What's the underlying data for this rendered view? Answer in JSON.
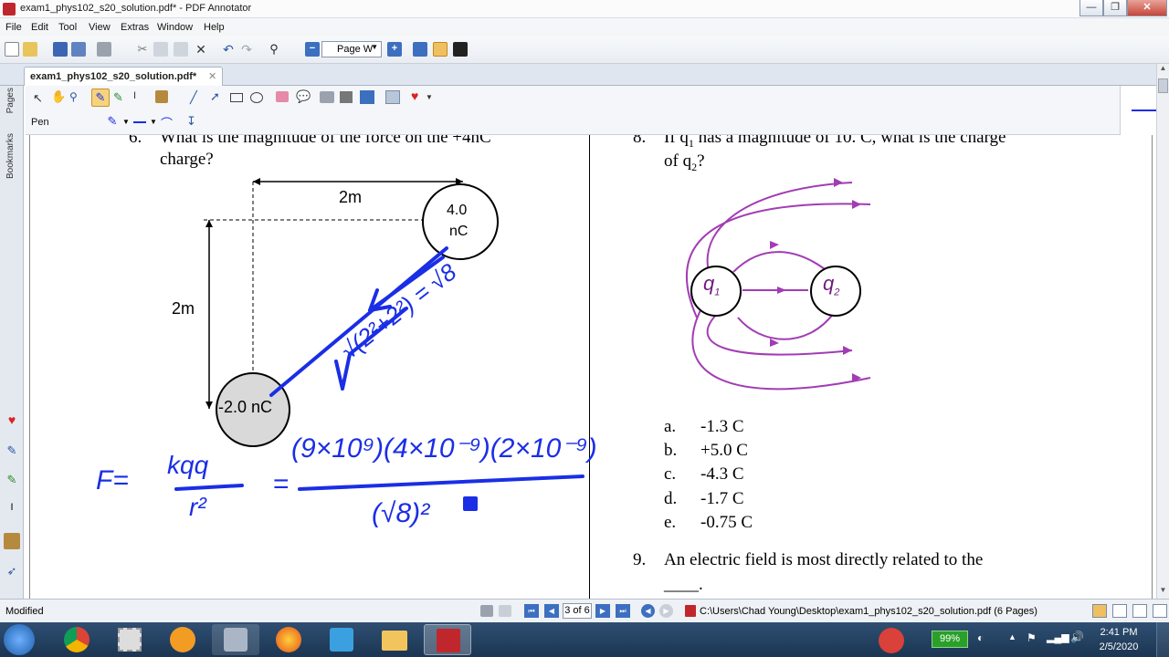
{
  "window": {
    "title": "exam1_phys102_s20_solution.pdf* - PDF Annotator",
    "min": "—",
    "max": "❐",
    "close": "✕"
  },
  "menu": [
    "File",
    "Edit",
    "Tool",
    "View",
    "Extras",
    "Window",
    "Help"
  ],
  "toolbar": {
    "page_width_select": "Page W"
  },
  "tabs": {
    "doc_tab_label": "exam1_phys102_s20_solution.pdf*",
    "close": "✕"
  },
  "sidebar": {
    "pages": "Pages",
    "bookmarks": "Bookmarks"
  },
  "ann_toolbar": {
    "tool_label": "Pen"
  },
  "document": {
    "q6_num": "6.",
    "q6_line1": "What is the magnitude of the force on the +4nC",
    "q6_line2": "charge?",
    "dist_top": "2m",
    "dist_left": "2m",
    "charge_pos_line1": "4.0",
    "charge_pos_line2": "nC",
    "charge_neg": "-2.0 nC",
    "q8_num": "8.",
    "q8_line1": "If q",
    "q8_sub1": "1",
    "q8_line1b": " has a magnitude of 10. C, what is the charge",
    "q8_line2": "of q",
    "q8_sub2": "2",
    "q8_line2b": "?",
    "fig_q1": "q",
    "fig_q1_sub": "1",
    "fig_q2": "q",
    "fig_q2_sub": "2",
    "answers": [
      {
        "letter": "a.",
        "text": "-1.3 C"
      },
      {
        "letter": "b.",
        "text": "+5.0 C"
      },
      {
        "letter": "c.",
        "text": "-4.3 C"
      },
      {
        "letter": "d.",
        "text": "-1.7 C"
      },
      {
        "letter": "e.",
        "text": "-0.75 C"
      }
    ],
    "q9_num": "9.",
    "q9_line1": "An electric field is most directly related to the",
    "q9_line2": "____.",
    "ink": {
      "F": "F=",
      "kqq": "kqq",
      "r2": "r²",
      "eq": "=",
      "numerator": "(9×10⁹)(4×10⁻⁹)(2×10⁻⁹)",
      "denominator": "(√8)²",
      "sqrt_expr": "√(2²+2²) = √8"
    },
    "ink_color": "#1a2ee6"
  },
  "status": {
    "modified": "Modified",
    "page_of": "3 of 6",
    "path": "C:\\Users\\Chad Young\\Desktop\\exam1_phys102_s20_solution.pdf (6 Pages)"
  },
  "taskbar": {
    "battery": "99%",
    "time": "2:41 PM",
    "date": "2/5/2020"
  }
}
